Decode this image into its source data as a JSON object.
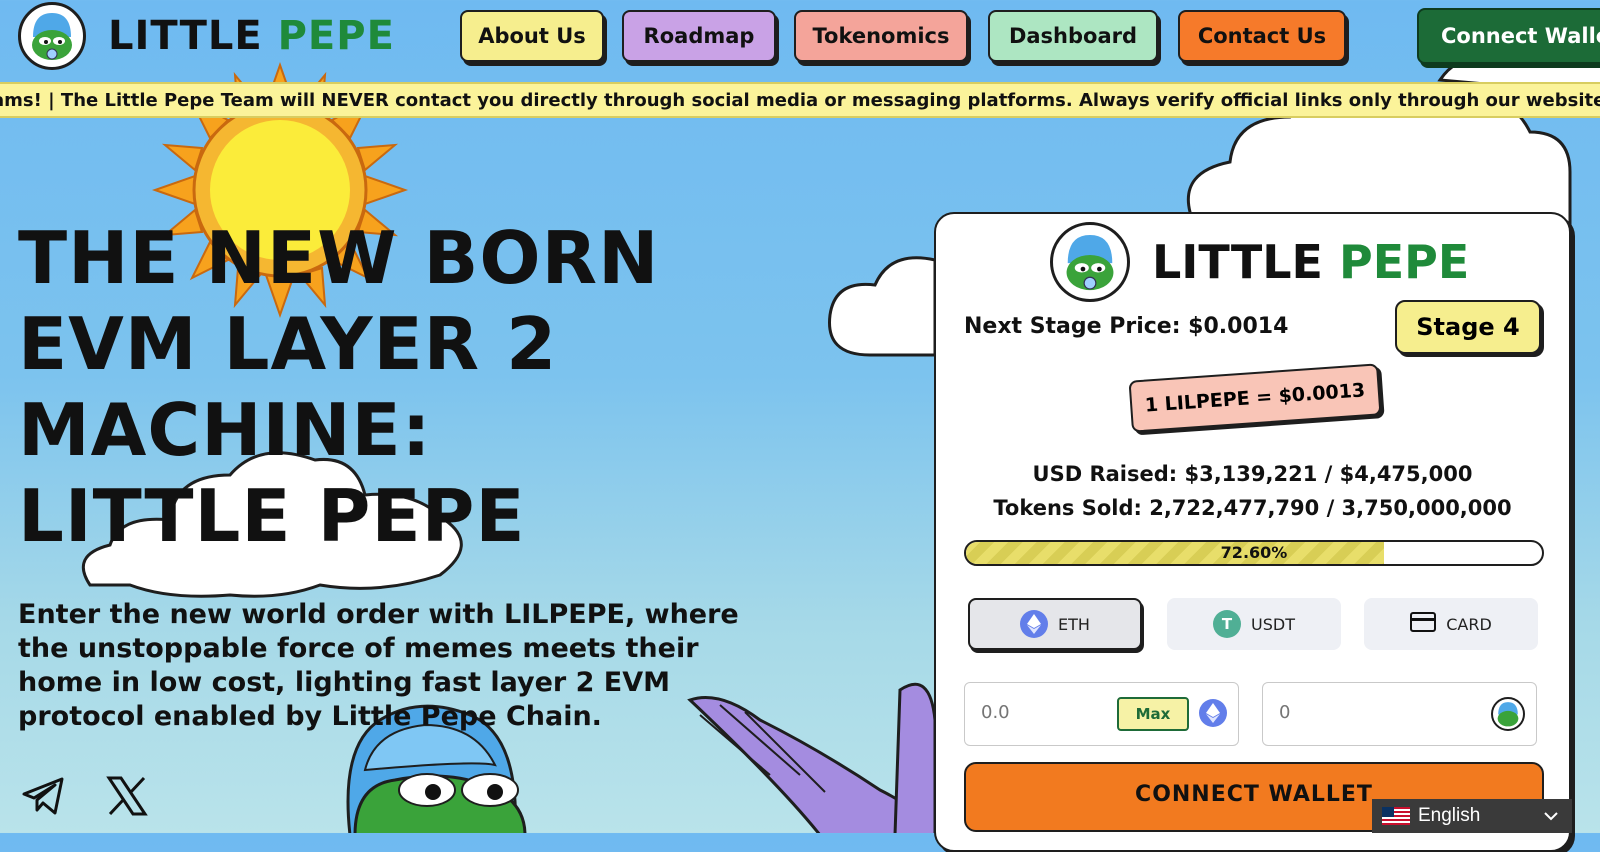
{
  "header": {
    "logo_word1": "LITTLE",
    "logo_word2": "PEPE",
    "nav": [
      {
        "label": "About Us",
        "color": "#f6ee8e"
      },
      {
        "label": "Roadmap",
        "color": "#c9a2e6"
      },
      {
        "label": "Tokenomics",
        "color": "#f4a49a"
      },
      {
        "label": "Dashboard",
        "color": "#ade6c2"
      },
      {
        "label": "Contact Us",
        "color": "#f67a2a"
      }
    ],
    "connect_label": "Connect Wallet"
  },
  "ticker": {
    "text": "ams! | The Little Pepe Team will NEVER contact you directly through social media or messaging platforms. Always verify official links only through our website: little"
  },
  "hero": {
    "title": "THE NEW BORN EVM LAYER 2 MACHINE: LITTLE PEPE",
    "subtitle": "Enter the new world order with LILPEPE, where the unstoppable force of memes meets their home in low cost, lighting fast layer 2 EVM protocol enabled by Little Pepe Chain.",
    "socials": [
      {
        "icon": "telegram-icon"
      },
      {
        "icon": "x-icon"
      }
    ]
  },
  "presale": {
    "logo_word1": "LITTLE",
    "logo_word2": "PEPE",
    "next_stage_price": "Next Stage Price: $0.0014",
    "stage": "Stage 4",
    "rate": "1 LILPEPE = $0.0013",
    "usd_raised": "USD Raised: $3,139,221 / $4,475,000",
    "tokens_sold": "Tokens Sold: 2,722,477,790 / 3,750,000,000",
    "progress_percent": 72.6,
    "progress_label": "72.60%",
    "payment_methods": [
      {
        "label": "ETH",
        "icon": "ethereum-icon",
        "active": true
      },
      {
        "label": "USDT",
        "icon": "tether-icon",
        "active": false
      },
      {
        "label": "CARD",
        "icon": "credit-card-icon",
        "active": false
      }
    ],
    "pay_input_placeholder": "0.0",
    "max_label": "Max",
    "receive_input_placeholder": "0",
    "connect_label": "CONNECT WALLET"
  },
  "language": {
    "selected": "English"
  },
  "colors": {
    "brand_green": "#1f8a3a",
    "connect_orange": "#f27a1f",
    "ticker_yellow": "#fbf39a",
    "sky_blue": "#6fbaf1"
  }
}
